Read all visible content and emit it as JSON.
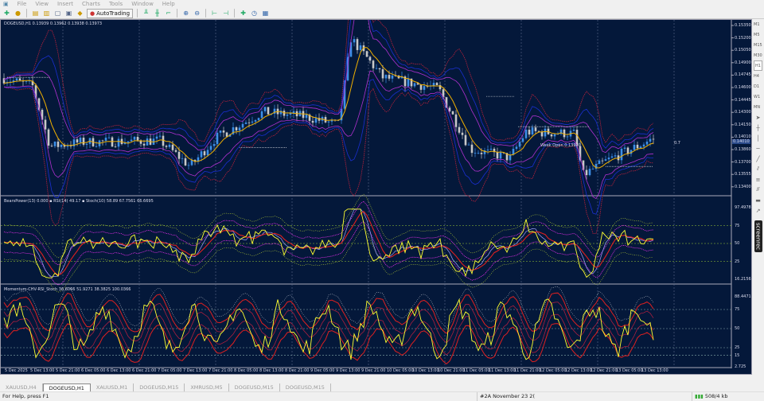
{
  "menu": [
    "File",
    "View",
    "Insert",
    "Charts",
    "Tools",
    "Window",
    "Help"
  ],
  "toolbar": {
    "autotrading": "AutoTrading"
  },
  "chart": {
    "main_header": "DOGEUSD,H1  0.13939 0.13962 0.13938 0.13973",
    "sub1_header": "BearsPower(13) 0.000  ▪ RSI(14) 49.17  ▪ Stoch(10) 58.89 67.7561 66.6695",
    "sub2_header": "Momentum-CHV-RSI_Stoch 36.6066 51.9271 38.3825 100.0366",
    "week_open_label": "Week Open 0.13970",
    "right_marker": "0.7",
    "current_price": "0.14010",
    "price_scale": [
      "0.15350",
      "0.15200",
      "0.15050",
      "0.14900",
      "0.14745",
      "0.14600",
      "0.14445",
      "0.14300",
      "0.14150",
      "0.14010",
      "0.13860",
      "0.13700",
      "0.13555",
      "0.13400"
    ],
    "sub1_scale": [
      "97.4978",
      "75",
      "50",
      "25",
      "16.2156"
    ],
    "sub2_scale": [
      "88.4471",
      "75",
      "50",
      "25",
      "15",
      "2.725"
    ],
    "time_labels": [
      "5 Dec 2025",
      "5 Dec 13:00",
      "5 Dec 21:00",
      "6 Dec 05:00",
      "6 Dec 13:00",
      "6 Dec 21:00",
      "7 Dec 05:00",
      "7 Dec 13:00",
      "7 Dec 21:00",
      "8 Dec 05:00",
      "8 Dec 13:00",
      "8 Dec 21:00",
      "9 Dec 05:00",
      "9 Dec 13:00",
      "9 Dec 21:00",
      "10 Dec 05:00",
      "10 Dec 13:00",
      "10 Dec 21:00",
      "11 Dec 05:00",
      "11 Dec 13:00",
      "11 Dec 21:00",
      "12 Dec 05:00",
      "12 Dec 13:00",
      "12 Dec 21:00",
      "13 Dec 05:00",
      "13 Dec 13:00"
    ],
    "price_path": [
      [
        0,
        0.1475
      ],
      [
        40,
        0.1465
      ],
      [
        62,
        0.1395
      ],
      [
        100,
        0.14
      ],
      [
        200,
        0.1402
      ],
      [
        238,
        0.1372
      ],
      [
        270,
        0.1405
      ],
      [
        330,
        0.1435
      ],
      [
        380,
        0.143
      ],
      [
        425,
        0.142
      ],
      [
        440,
        0.152
      ],
      [
        480,
        0.1475
      ],
      [
        550,
        0.1462
      ],
      [
        590,
        0.1392
      ],
      [
        640,
        0.1382
      ],
      [
        660,
        0.1412
      ],
      [
        720,
        0.141
      ],
      [
        732,
        0.1362
      ],
      [
        760,
        0.1378
      ],
      [
        822,
        0.1405
      ]
    ],
    "colors": {
      "bg": "#04183a",
      "bull": "#3d8fe8",
      "bear": "#c8c8c8",
      "ma": "#f0b000",
      "band_outer": "#c0213a",
      "band_mid": "#1a2fd0",
      "band_inner": "#b030d0",
      "osc": "#ffff30",
      "grid": "#5a6a8a"
    }
  },
  "timeframes": [
    "M1",
    "M5",
    "M15",
    "M30",
    "H1",
    "H4",
    "D1",
    "W1",
    "MN"
  ],
  "active_timeframe": "H1",
  "screenrec": "screenrec",
  "tabs": [
    "XAUUSD,H4",
    "DOGEUSD,H1",
    "XAUUSD,M1",
    "DOGEUSD,M15",
    "XMRUSD,M5",
    "DOGEUSD,M15",
    "DOGEUSD,M15"
  ],
  "active_tab": "DOGEUSD,H1",
  "status": {
    "help": "For Help, press F1",
    "profile": "#2A November 23 2(",
    "traffic": "508/4 kb"
  }
}
